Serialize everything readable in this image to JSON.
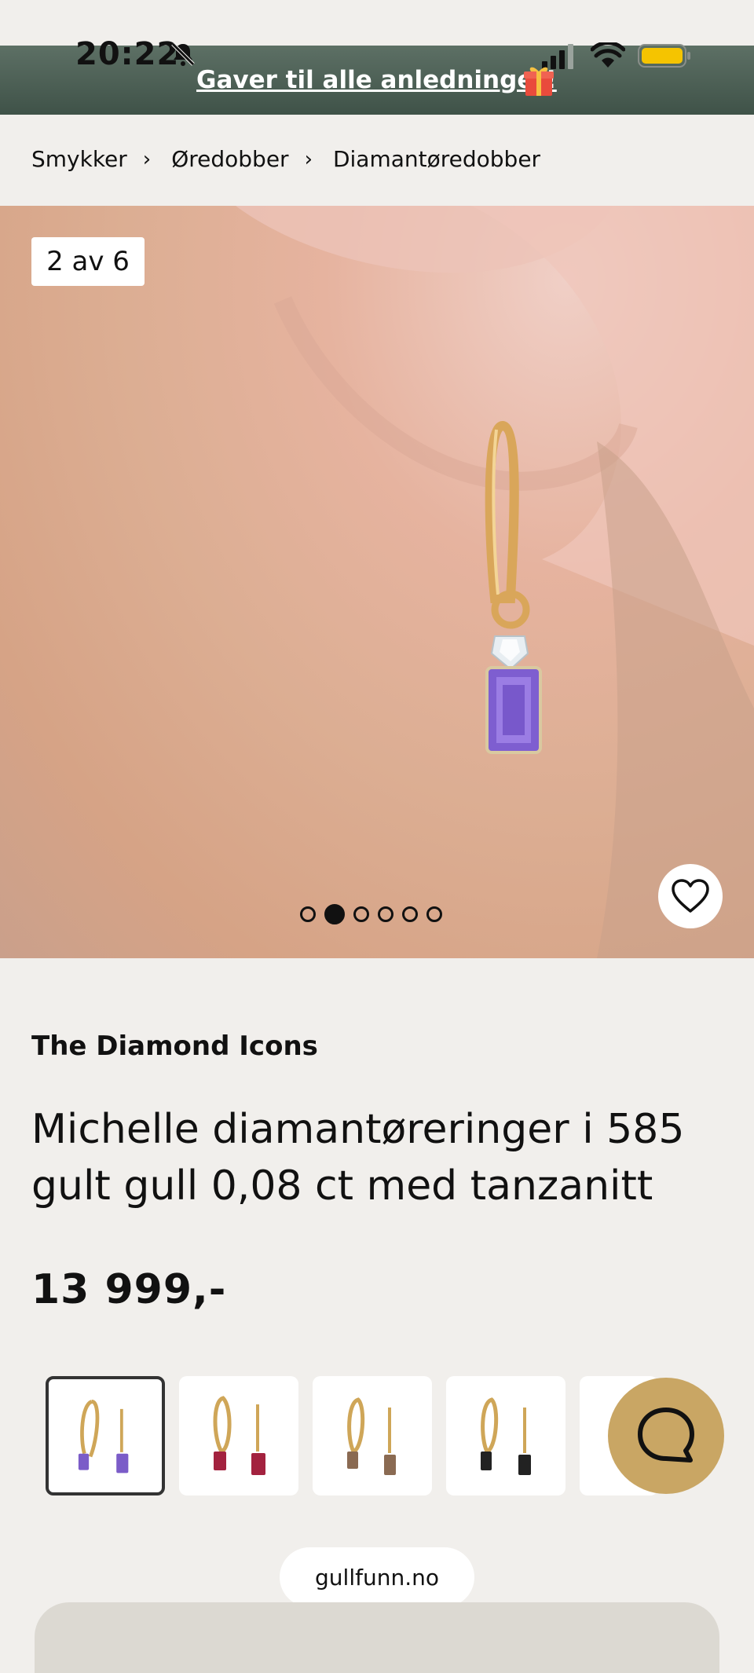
{
  "status_bar": {
    "time": "20:22",
    "icons": [
      "bell-muted-icon",
      "signal-icon",
      "wifi-icon",
      "battery-icon"
    ],
    "battery_color": "#f5c400"
  },
  "banner": {
    "text": "Gaver til alle anledninger!",
    "icon": "gift-icon",
    "background": "#4d6057"
  },
  "breadcrumb": [
    {
      "label": "Smykker"
    },
    {
      "label": "Øredobber"
    },
    {
      "label": "Diamantøredobber"
    }
  ],
  "gallery": {
    "counter": "2 av 6",
    "total": 6,
    "active_index": 1,
    "favorite_icon": "heart-icon"
  },
  "product": {
    "brand": "The Diamond Icons",
    "title": "Michelle diamantøreringer i 585 gult gull 0,08 ct med tanzanitt",
    "price": "13 999,-"
  },
  "variants": [
    {
      "stone_color": "#7b5cc8",
      "selected": true
    },
    {
      "stone_color": "#a3223f",
      "selected": false
    },
    {
      "stone_color": "#8a6a52",
      "selected": false
    },
    {
      "stone_color": "#222222",
      "selected": false
    },
    {
      "stone_color": "#cccccc",
      "selected": false
    }
  ],
  "chat": {
    "icon": "chat-icon",
    "color": "#c9a664"
  },
  "browser": {
    "domain": "gullfunn.no"
  }
}
